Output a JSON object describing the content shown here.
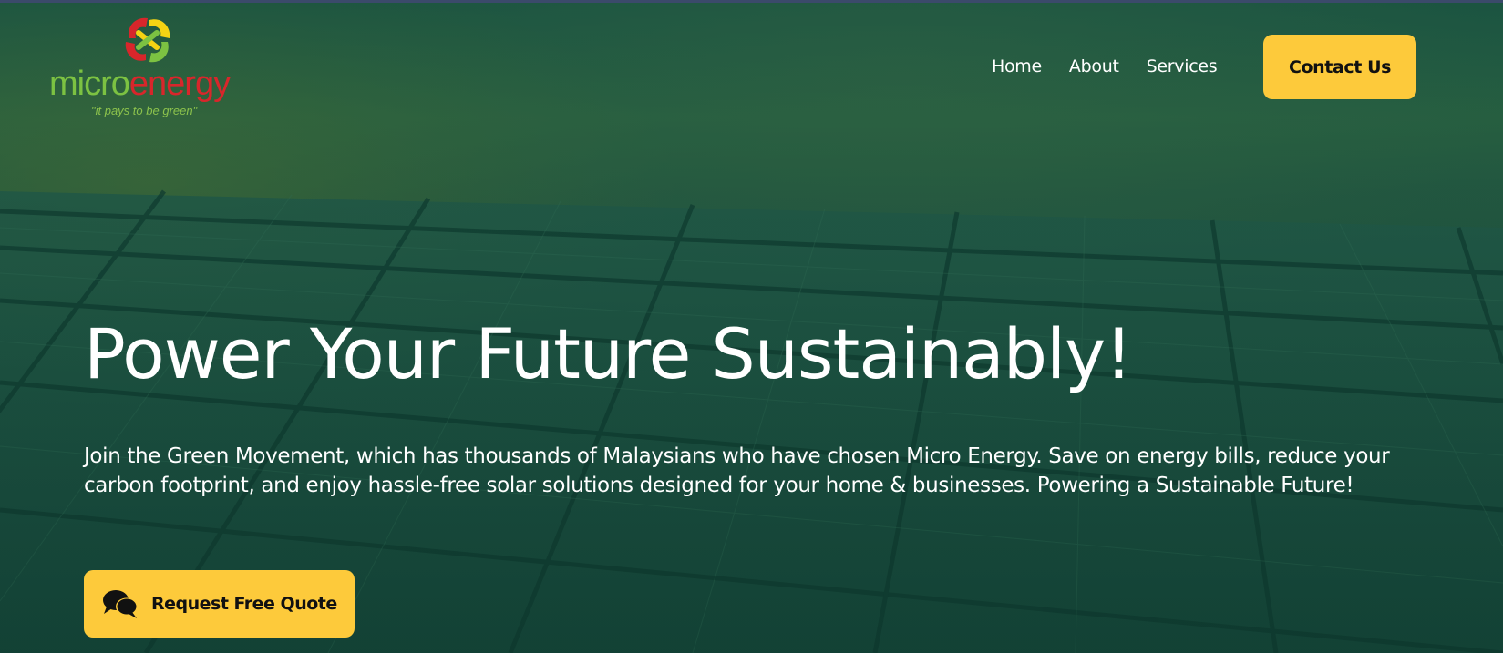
{
  "brand": {
    "name_part1": "micro",
    "name_part2": "energy",
    "tagline": "\"it pays to be  green\"",
    "colors": {
      "green": "#7cc242",
      "red": "#d8262b",
      "yellow": "#f5d313"
    }
  },
  "nav": {
    "items": [
      {
        "label": "Home"
      },
      {
        "label": "About"
      },
      {
        "label": "Services"
      }
    ],
    "contact_label": "Contact Us"
  },
  "hero": {
    "headline": "Power Your Future Sustainably!",
    "subtext": "Join the Green Movement, which has thousands of Malaysians who have chosen Micro Energy. Save on energy bills, reduce your carbon footprint, and enjoy hassle-free solar solutions designed for your home & businesses. Powering a Sustainable Future!",
    "cta_label": "Request Free Quote",
    "cta_icon": "comments-icon"
  },
  "theme": {
    "accent": "#fdca3b",
    "overlay": "#17493a",
    "text": "#ffffff"
  }
}
